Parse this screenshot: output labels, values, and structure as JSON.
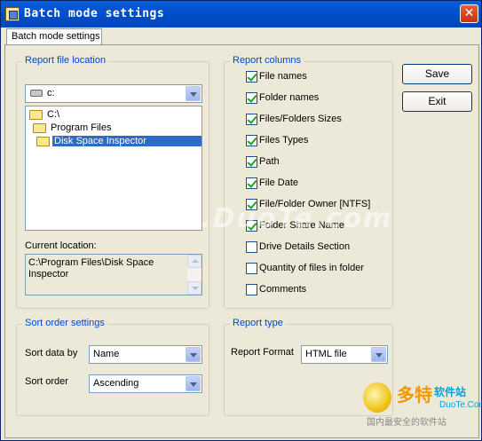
{
  "window": {
    "title": "Batch mode settings",
    "close_glyph": "✕"
  },
  "tab": {
    "label": "Batch mode settings"
  },
  "buttons": {
    "save": "Save",
    "exit": "Exit"
  },
  "report_location": {
    "group_label": "Report file location",
    "drive": "c:",
    "tree": [
      {
        "label": "C:\\",
        "icon": "folder-open-icon"
      },
      {
        "label": "Program Files",
        "icon": "folder-open-icon"
      },
      {
        "label": "Disk Space Inspector",
        "icon": "folder-open-icon",
        "selected": true
      }
    ],
    "current_label": "Current location:",
    "current_value": "C:\\Program Files\\Disk Space Inspector"
  },
  "report_columns": {
    "group_label": "Report columns",
    "items": [
      {
        "label": "File names",
        "checked": true
      },
      {
        "label": "Folder names",
        "checked": true
      },
      {
        "label": "Files/Folders Sizes",
        "checked": true
      },
      {
        "label": "Files Types",
        "checked": true
      },
      {
        "label": "Path",
        "checked": true
      },
      {
        "label": "File Date",
        "checked": true
      },
      {
        "label": "File/Folder Owner [NTFS]",
        "checked": true
      },
      {
        "label": "Folder Share Name",
        "checked": true
      },
      {
        "label": "Drive Details Section",
        "checked": false
      },
      {
        "label": "Quantity of files in folder",
        "checked": false
      },
      {
        "label": "Comments",
        "checked": false
      }
    ]
  },
  "sort_order": {
    "group_label": "Sort order settings",
    "sort_by_label": "Sort data by",
    "sort_by_value": "Name",
    "order_label": "Sort order",
    "order_value": "Ascending"
  },
  "report_type": {
    "group_label": "Report type",
    "format_label": "Report Format",
    "format_value": "HTML file"
  },
  "watermark": {
    "text": "www.DuoTe.com"
  },
  "logo": {
    "brand": "多特",
    "brand_suffix": "软件站",
    "site": "DuoTe.Com",
    "slogan": "国内最安全的软件站"
  },
  "colors": {
    "titlebar": "#0050d0",
    "group_label": "#0046d5",
    "selection": "#316ac5",
    "face": "#ece9d8"
  }
}
